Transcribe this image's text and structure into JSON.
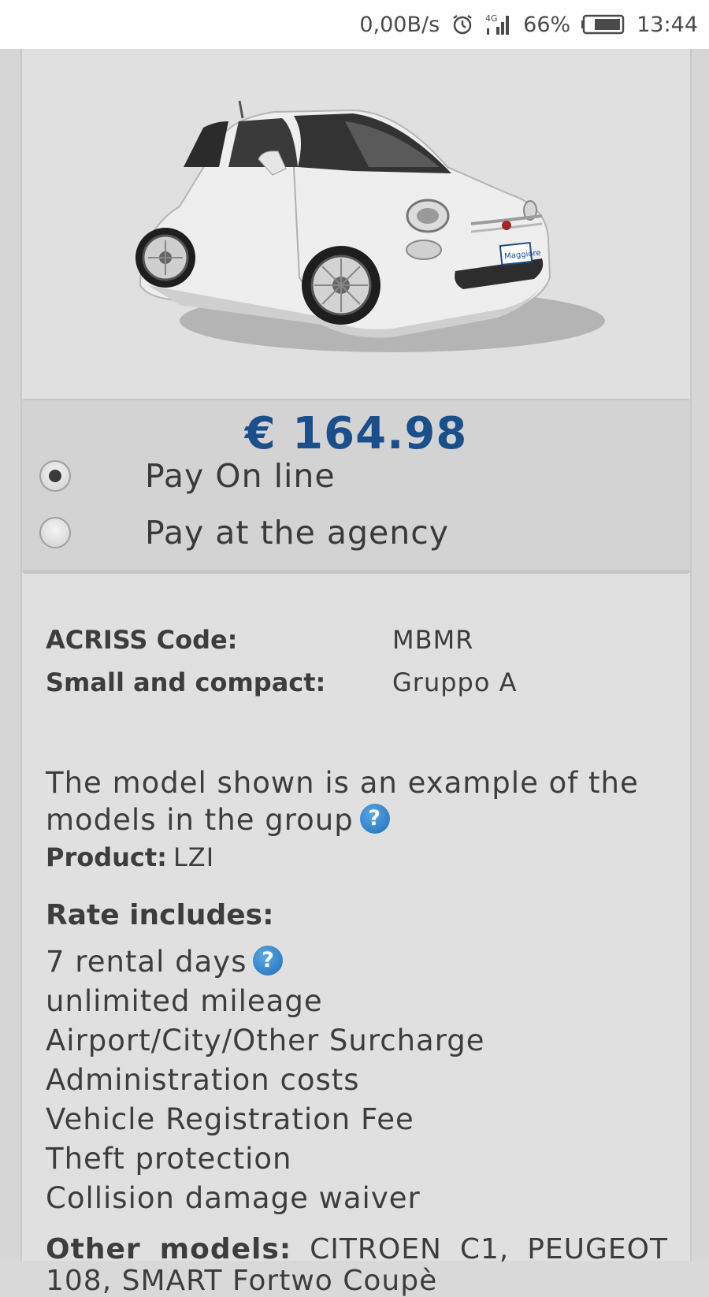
{
  "status_bar": {
    "net_speed": "0,00B/s",
    "alarm_icon": "alarm-clock-icon",
    "network": "4G",
    "battery_percent": "66%",
    "time": "13:44"
  },
  "car_image": {
    "icon": "car-photo",
    "plate_text": "Maggiore"
  },
  "pricing": {
    "price": "€ 164.98",
    "options": [
      {
        "label": "Pay On line",
        "selected": true
      },
      {
        "label": "Pay at the agency",
        "selected": false
      }
    ]
  },
  "details": {
    "acriss_label": "ACRISS Code:",
    "acriss_value": "MBMR",
    "category_label": "Small and compact:",
    "category_value": "Gruppo A",
    "note": "The model shown is an example of the models in the group",
    "product_label": "Product:",
    "product_value": "LZI"
  },
  "rate": {
    "title": "Rate includes:",
    "items": [
      "7 rental days",
      "unlimited mileage",
      "Airport/City/Other Surcharge",
      "Administration costs",
      "Vehicle Registration Fee",
      "Theft protection",
      "Collision damage waiver"
    ]
  },
  "other_models": {
    "label": "Other models:",
    "value": "CITROEN C1, PEUGEOT 108, SMART Fortwo Coupè"
  },
  "colors": {
    "price_blue": "#1a4f8b",
    "help_blue": "#2a7cc7",
    "text": "#3d3d3d"
  }
}
